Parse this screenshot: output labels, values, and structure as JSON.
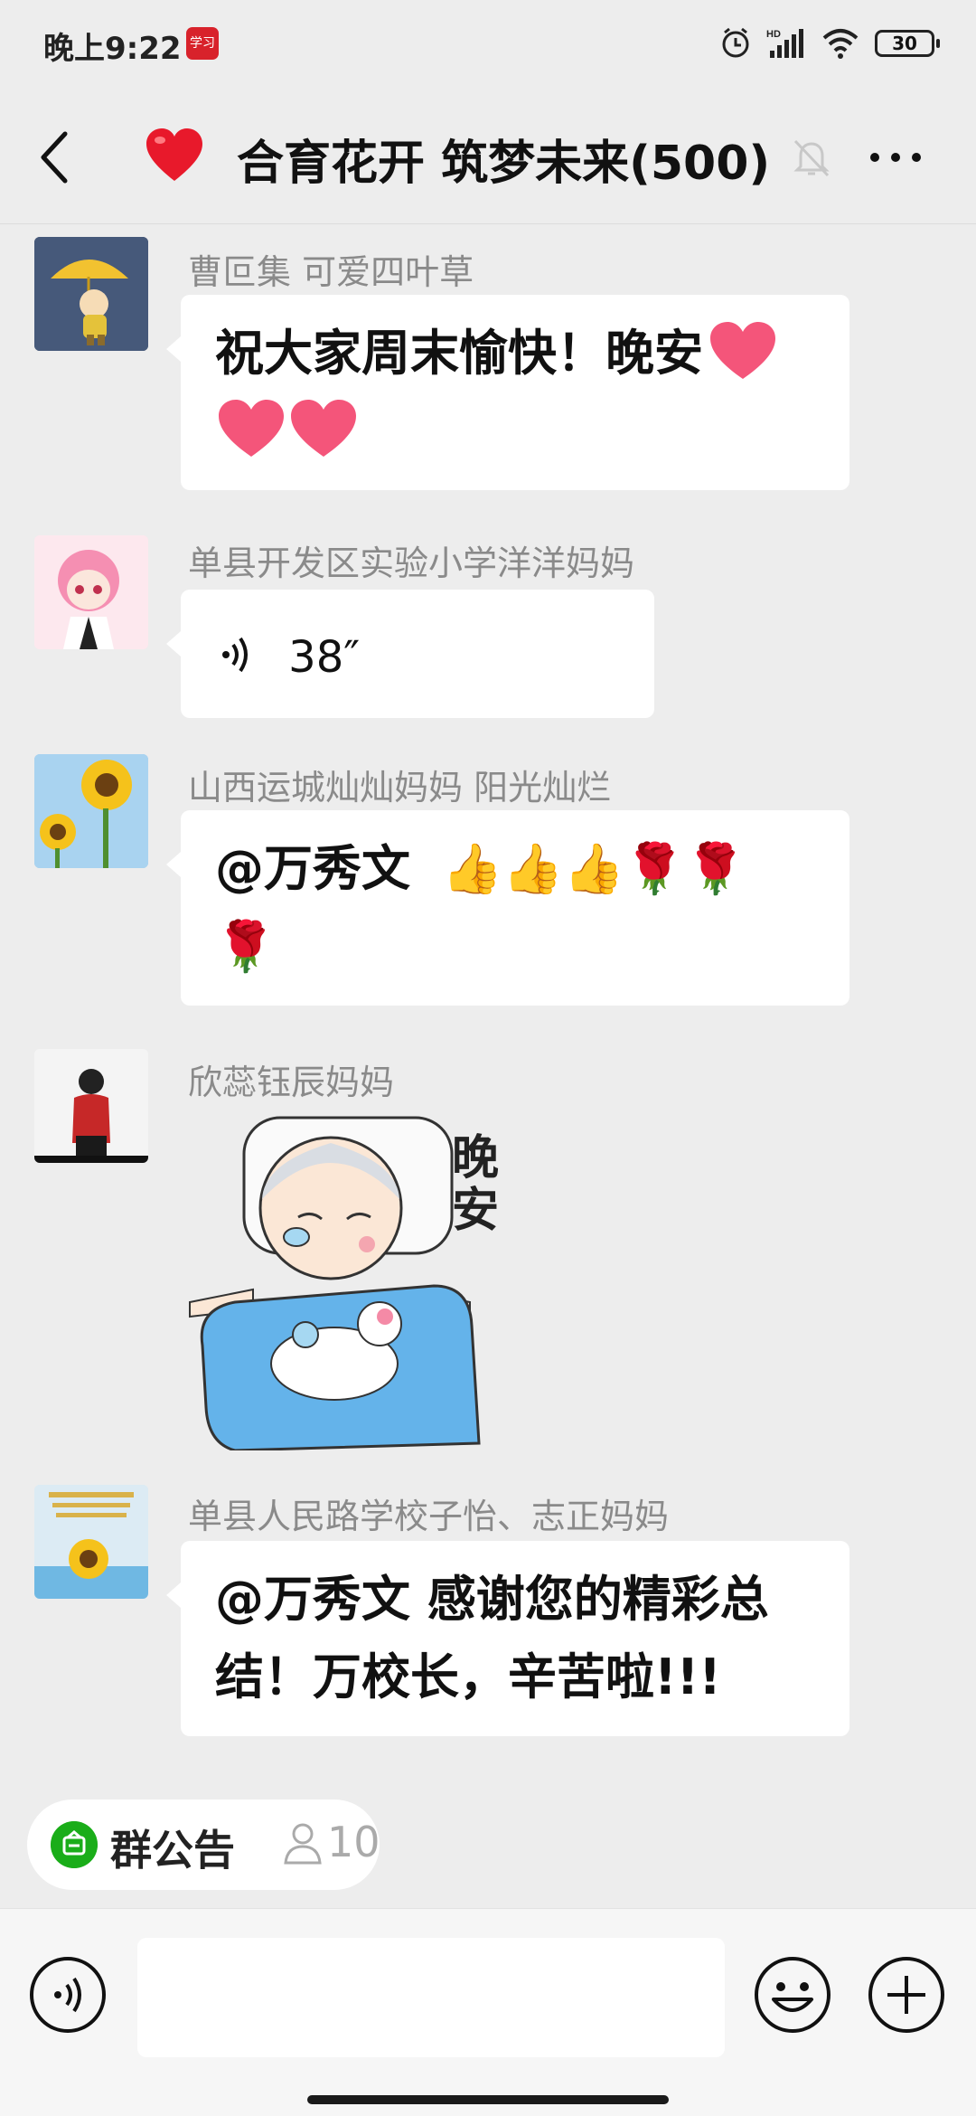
{
  "status_bar": {
    "time": "晚上9:22",
    "app_badge": "学习",
    "network": "HD",
    "battery": "30"
  },
  "chat": {
    "title": "合育花开 筑梦未来(500)",
    "title_icon": "heart-icon",
    "back_icon": "chevron-left-icon",
    "mute_icon": "bell-off-icon",
    "more_icon": "ellipsis-icon"
  },
  "messages": [
    {
      "sender": "曹叵集 可爱四叶草",
      "text": "祝大家周末愉快！晚安",
      "text_line2": "",
      "type": "text"
    },
    {
      "sender": "单县开发区实验小学洋洋妈妈",
      "voice_duration": "38″",
      "type": "voice"
    },
    {
      "sender": "山西运城灿灿妈妈  阳光灿烂",
      "text": "@万秀文",
      "type": "text"
    },
    {
      "sender": "欣蕊钰辰妈妈",
      "sticker_text": "晚安",
      "type": "sticker"
    },
    {
      "sender": "单县人民路学校子怡、志正妈妈",
      "text": "@万秀文  感谢您的精彩总",
      "text_line2": "结！万校长，辛苦啦!!!",
      "type": "text"
    }
  ],
  "notice": {
    "label": "群公告",
    "count": "10"
  },
  "input": {
    "placeholder": ""
  },
  "colors": {
    "background": "#ededed",
    "bubble": "#ffffff",
    "notice_green": "#1aad19",
    "heart_red": "#e8192b"
  }
}
